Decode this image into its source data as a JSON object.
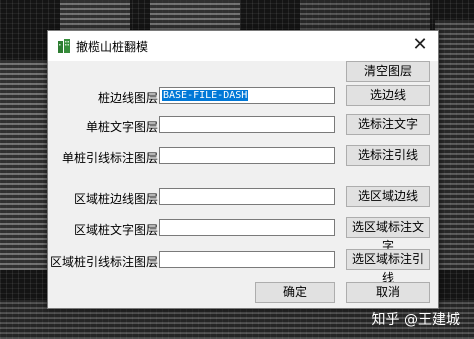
{
  "window": {
    "title": "撤榄山桩翻模"
  },
  "rows": [
    {
      "label": "",
      "value": "",
      "button": "清空图层"
    },
    {
      "label": "桩边线图层",
      "value": "BASE-FILE-DASH",
      "button": "选边线"
    },
    {
      "label": "单桩文字图层",
      "value": "",
      "button": "选标注文字"
    },
    {
      "label": "单桩引线标注图层",
      "value": "",
      "button": "选标注引线"
    },
    {
      "label": "区域桩边线图层",
      "value": "",
      "button": "选区域边线"
    },
    {
      "label": "区域桩文字图层",
      "value": "",
      "button": "选区域标注文字"
    },
    {
      "label": "区域桩引线标注图层",
      "value": "",
      "button": "选区域标注引线"
    }
  ],
  "footer": {
    "ok": "确定",
    "cancel": "取消"
  },
  "watermark": "知乎 @王建城",
  "icons": {
    "app": "building-icon",
    "close": "close-icon"
  }
}
